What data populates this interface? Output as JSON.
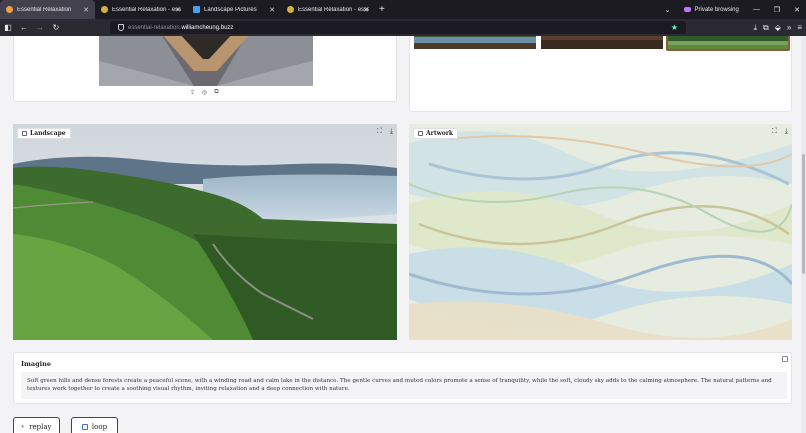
{
  "browser": {
    "tabs": [
      {
        "label": "Essential Relaxation",
        "active": true
      },
      {
        "label": "Essential Relaxation - essential",
        "active": false
      },
      {
        "label": "Landscape Pictures",
        "active": false
      },
      {
        "label": "Essential Relaxation - essential",
        "active": false
      }
    ],
    "new_tab": "+",
    "private_label": "Private browsing",
    "url_dim": "essential-relaxation.",
    "url_host": "williamcheung.buzz"
  },
  "cards": {
    "landscape_label": "Landscape",
    "artwork_label": "Artwork"
  },
  "imagine": {
    "title": "Imagine",
    "text": "Soft green hills and dense forests create a peaceful scene, with a winding road and calm lake in the distance. The gentle curves and muted colors promote a sense of tranquility, while the soft, cloudy sky adds to the calming atmosphere. The natural patterns and textures work together to create a soothing visual rhythm, inviting relaxation and a deep connection with nature."
  },
  "buttons": {
    "replay": "replay",
    "loop": "loop"
  },
  "colors": {
    "chrome_dark": "#1c1b22",
    "chrome_mid": "#2b2a33",
    "accent_star": "#54ffbd",
    "private_purple": "#b678ff",
    "loop_blue": "#3b6fd8"
  }
}
